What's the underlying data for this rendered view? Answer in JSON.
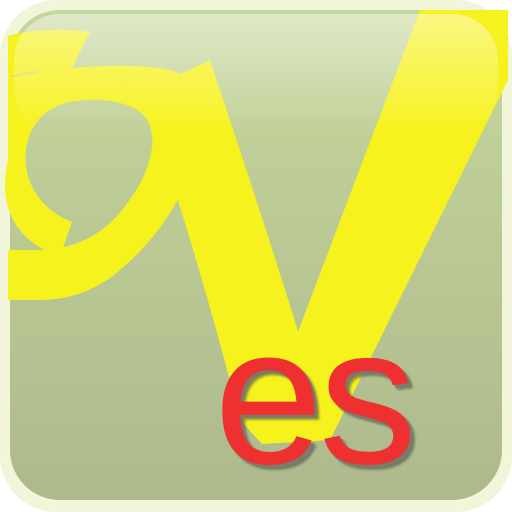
{
  "app_icon": {
    "wordmark": "es",
    "logo_glyph_icon": "stylized-yellow-v-with-curl-icon",
    "colors": {
      "background_top": "#c2d49a",
      "background_bottom": "#b0ba8e",
      "frame_glow": "#f2f7dc",
      "glyph_yellow": "#f6f21e",
      "wordmark_red": "#ee3030",
      "wordmark_shadow": "#7b7b6c"
    }
  }
}
